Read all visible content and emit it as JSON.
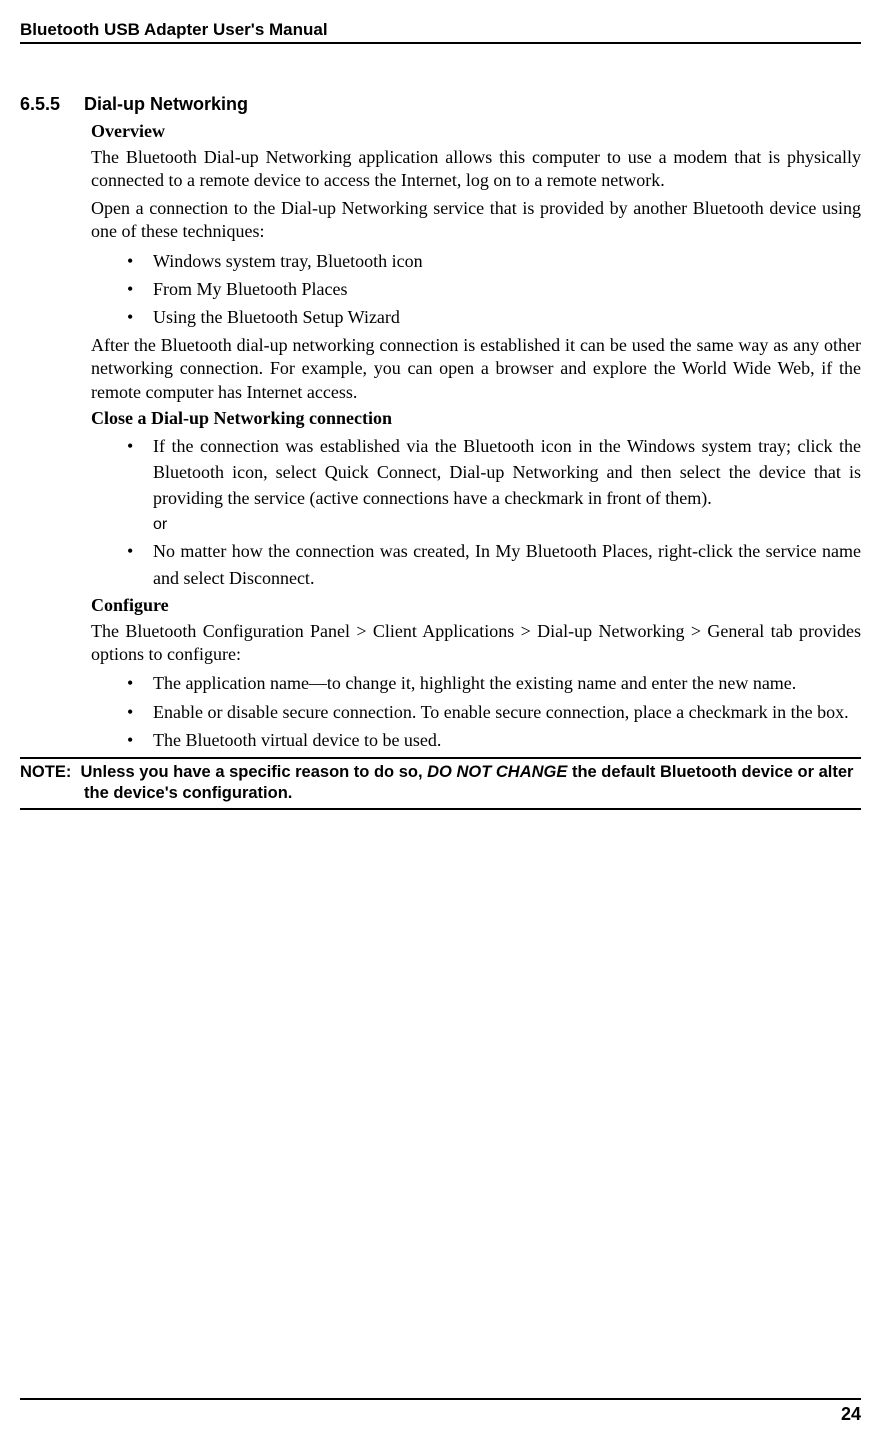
{
  "header": {
    "title": "Bluetooth USB Adapter User's Manual"
  },
  "section": {
    "number": "6.5.5",
    "title": "Dial-up Networking"
  },
  "overview": {
    "heading": "Overview",
    "p1": "The Bluetooth Dial-up Networking application allows this computer to use a modem that is physically connected to a remote device to access the Internet, log on to a remote network.",
    "p2": "Open a connection to the Dial-up Networking service that is provided by another Bluetooth device using one of these techniques:",
    "bullets": {
      "b1": "Windows system tray, Bluetooth icon",
      "b2": "From My Bluetooth Places",
      "b3": "Using the Bluetooth Setup Wizard"
    },
    "p3": "After the Bluetooth dial-up networking connection is established it can be used the same way as any other networking connection. For example, you can open a browser and explore the World Wide Web, if the remote computer has Internet access."
  },
  "close": {
    "heading": "Close a Dial-up Networking connection",
    "bullets": {
      "b1": "If the connection was established via the Bluetooth icon in the Windows system tray; click the Bluetooth icon, select Quick Connect, Dial-up Networking and then select the device that is providing the service (active connections have a checkmark in front of them).",
      "or": "or",
      "b2": "No matter how the connection was created, In My Bluetooth Places, right-click the service name and select Disconnect."
    }
  },
  "configure": {
    "heading": "Configure",
    "p1": "The Bluetooth Configuration Panel > Client Applications > Dial-up Networking > General tab provides options to configure:",
    "bullets": {
      "b1": "The application name—to change it, highlight the existing name and enter the new name.",
      "b2": "Enable or disable secure connection. To enable secure connection, place a checkmark in the box.",
      "b3": "The Bluetooth virtual device to be used."
    }
  },
  "note": {
    "label": "NOTE:",
    "text_before": "Unless you have a specific reason to do so, ",
    "emphasis": "DO NOT CHANGE",
    "text_after": " the default Bluetooth device or alter the device's configuration."
  },
  "footer": {
    "page": "24"
  }
}
